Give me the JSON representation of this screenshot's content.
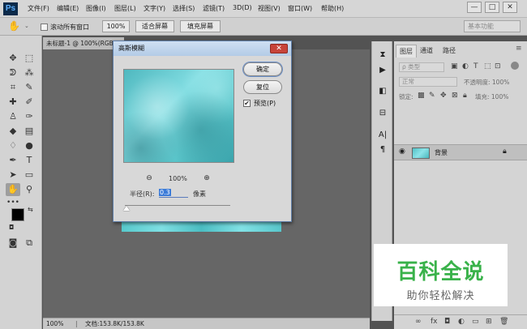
{
  "app": {
    "logo": "Ps"
  },
  "menu": [
    "文件(F)",
    "编辑(E)",
    "图像(I)",
    "图层(L)",
    "文字(Y)",
    "选择(S)",
    "滤镜(T)",
    "3D(D)",
    "视图(V)",
    "窗口(W)",
    "帮助(H)"
  ],
  "window_controls": {
    "minimize": "—",
    "restore": "□",
    "close": "✕"
  },
  "options_bar": {
    "scroll_all_windows": "滚动所有窗口",
    "zoom_100": "100%",
    "fit_screen": "适合屏幕",
    "fill_screen": "填充屏幕",
    "workspace": "基本功能"
  },
  "document": {
    "tab_title": "未标题-1 @ 100%(RGB",
    "status_zoom": "100%",
    "status_doc": "文档:153.8K/153.8K"
  },
  "dialog": {
    "title": "高斯模糊",
    "close": "✕",
    "ok": "确定",
    "reset": "复位",
    "preview": "预览(P)",
    "preview_checked": "✔",
    "zoom_out": "⊖",
    "zoom_in": "⊕",
    "zoom": "100%",
    "radius_label": "半径(R):",
    "radius_value": "0.3",
    "radius_unit": "像素"
  },
  "layers_panel": {
    "tabs": [
      "图层",
      "通道",
      "路径"
    ],
    "kind_filter": "ρ 类型",
    "blend_mode": "正常",
    "opacity_label": "不透明度: 100%",
    "lock_label": "锁定:",
    "fill_label": "填充: 100%",
    "layer_name": "背景"
  },
  "watermark": {
    "title": "百科全说",
    "subtitle": "助你轻松解决"
  }
}
